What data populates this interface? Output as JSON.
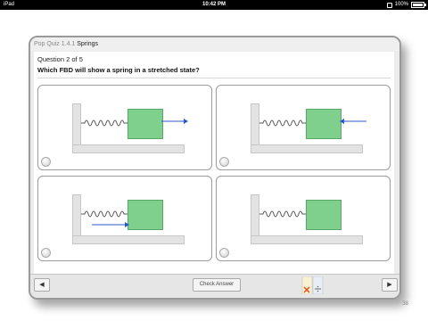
{
  "status_bar": {
    "device": "iPad",
    "time": "10:42 PM",
    "battery": "100%"
  },
  "quiz": {
    "title_prefix": "Pop Quiz 1.4.1",
    "title": "Springs",
    "question_counter": "Question 2 of 5",
    "question": "Which FBD will show a spring in a stretched state?",
    "options": [
      {
        "arrow": "right",
        "arrow_position": "on-block-right"
      },
      {
        "arrow": "left",
        "arrow_position": "on-block-right"
      },
      {
        "arrow": "right",
        "arrow_position": "under-spring"
      },
      {
        "arrow": "none",
        "arrow_position": "none"
      }
    ]
  },
  "toolbar": {
    "prev_icon": "arrow-left-icon",
    "check_label": "Check Answer",
    "tools_icon": "calculator-icon",
    "next_icon": "arrow-right-icon"
  },
  "page_number": "38",
  "colors": {
    "block": "#7fd08d",
    "arrow": "#2b58c8",
    "card_border": "#9a9a9a"
  }
}
